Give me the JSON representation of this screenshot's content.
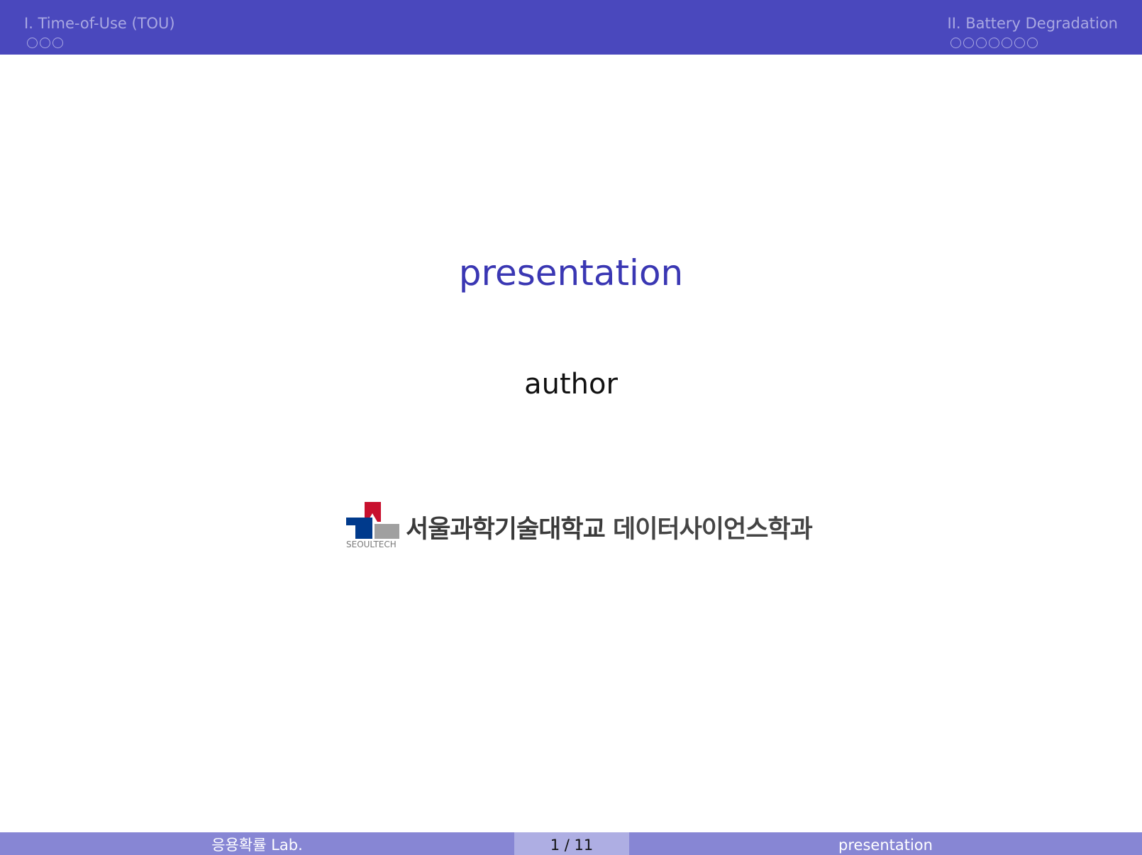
{
  "header": {
    "sections": [
      {
        "title": "I. Time-of-Use (TOU)",
        "dot_count": 3
      },
      {
        "title": "II. Battery Degradation",
        "dot_count": 7
      }
    ]
  },
  "slide": {
    "title": "presentation",
    "author": "author",
    "logo": {
      "caption": "SEOULTECH",
      "university": "서울과학기술대학교",
      "department": "데이터사이언스학과"
    }
  },
  "footer": {
    "left": "응용확률 Lab.",
    "page": "1 / 11",
    "right": "presentation"
  },
  "colors": {
    "header_bg": "#4a48bd",
    "title": "#3a37b3",
    "footer_bg": "#8786d4",
    "footer_page_bg": "#aeaee3",
    "logo_red": "#c8102e",
    "logo_blue": "#003a8c",
    "logo_gray": "#a0a0a0"
  }
}
